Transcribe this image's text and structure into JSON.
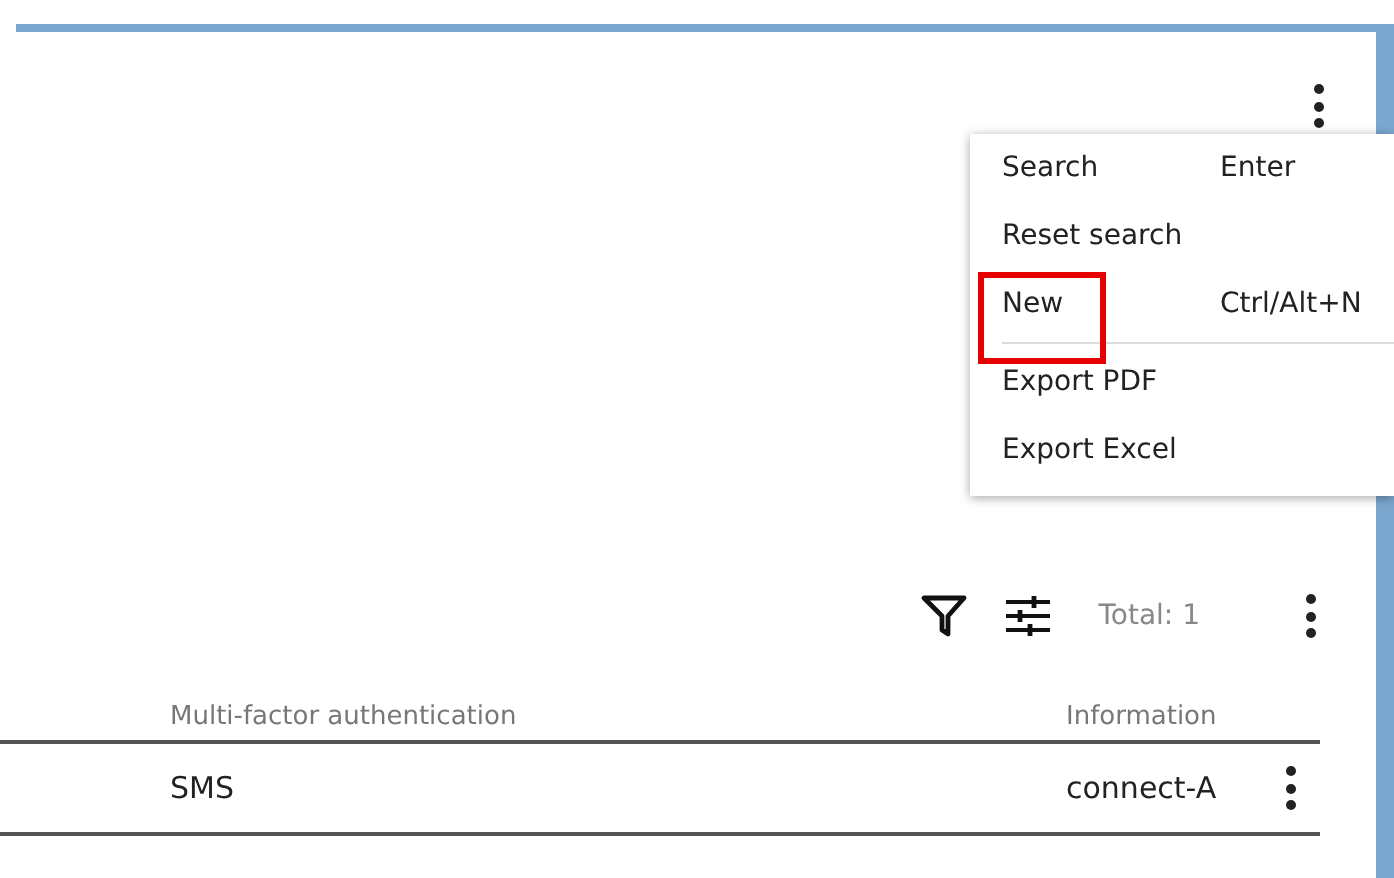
{
  "toolbar": {
    "total": "Total: 1"
  },
  "menu": {
    "items": [
      {
        "kind": "item",
        "label": "Search",
        "shortcut": "Enter",
        "highlighted": false
      },
      {
        "kind": "item",
        "label": "Reset search",
        "highlighted": false
      },
      {
        "kind": "item",
        "label": "New",
        "shortcut": "Ctrl/Alt+N",
        "highlighted": true
      },
      {
        "kind": "divider"
      },
      {
        "kind": "item",
        "label": "Export PDF",
        "highlighted": false
      },
      {
        "kind": "item",
        "label": "Export Excel",
        "highlighted": false
      }
    ]
  },
  "table": {
    "columns": [
      "Multi-factor authentication",
      "Information"
    ],
    "rows": [
      [
        "SMS",
        "connect-A"
      ]
    ]
  }
}
